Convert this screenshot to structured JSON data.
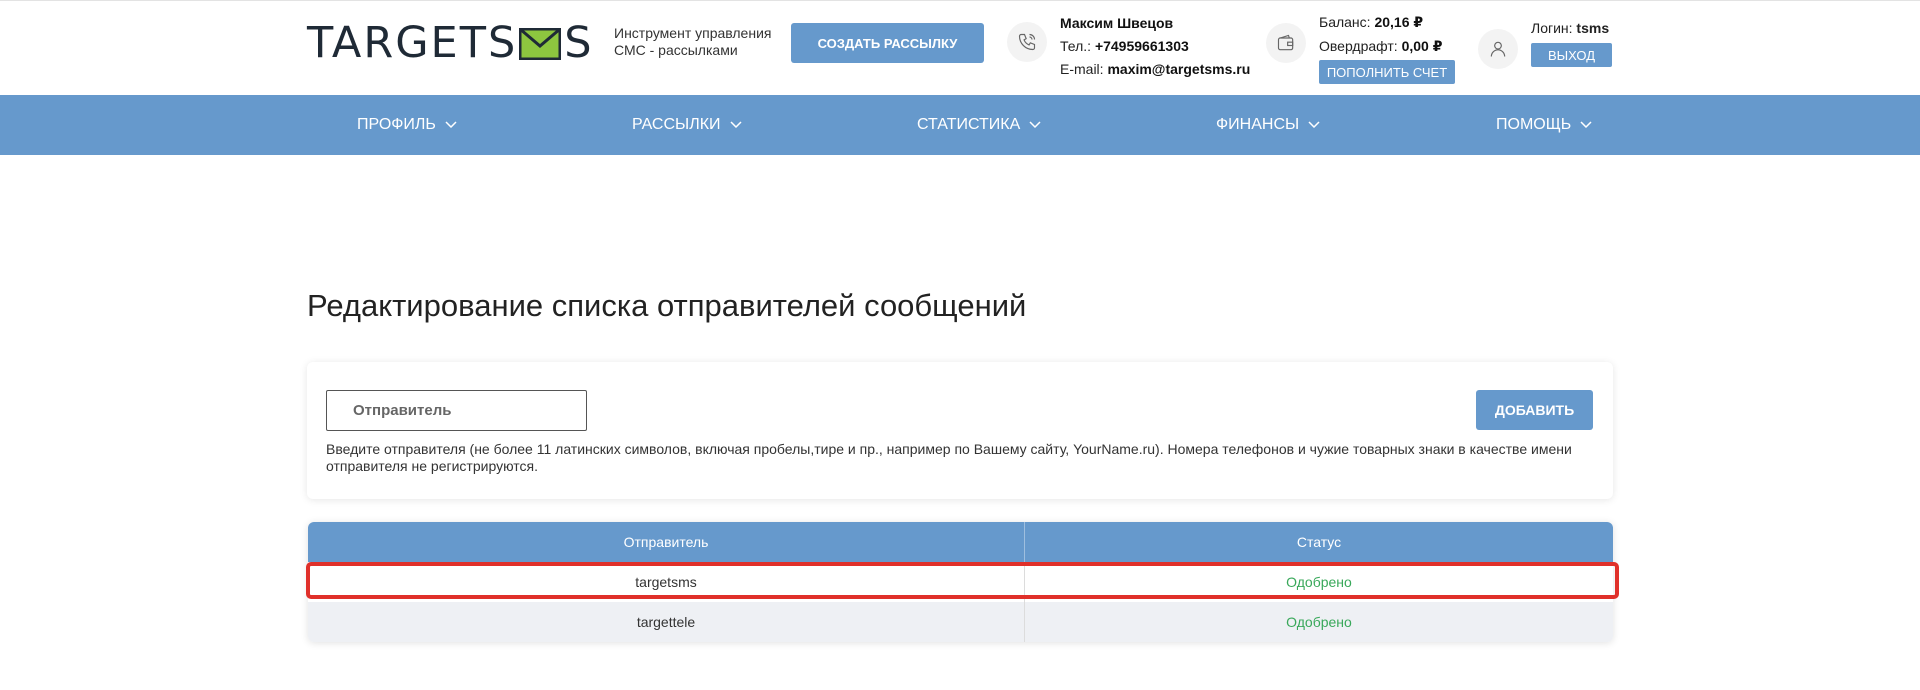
{
  "header": {
    "logo_text_left": "TARGETS",
    "logo_text_right": "S",
    "tagline": "Инструмент управления СМС - рассылками",
    "create_button": "СОЗДАТЬ РАССЫЛКУ",
    "contact": {
      "name": "Максим Швецов",
      "phone_label": "Тел.:",
      "phone": "+74959661303",
      "email_label": "E-mail:",
      "email": "maxim@targetsms.ru"
    },
    "balance": {
      "balance_label": "Баланс:",
      "balance_value": "20,16 ₽",
      "overdraft_label": "Овердрафт:",
      "overdraft_value": "0,00 ₽",
      "topup_button": "ПОПОЛНИТЬ СЧЕТ"
    },
    "account": {
      "login_label": "Логин:",
      "login_value": "tsms",
      "logout_button": "ВЫХОД"
    }
  },
  "nav": {
    "items": [
      {
        "label": "ПРОФИЛЬ"
      },
      {
        "label": "РАССЫЛКИ"
      },
      {
        "label": "СТАТИСТИКА"
      },
      {
        "label": "ФИНАНСЫ"
      },
      {
        "label": "ПОМОЩЬ"
      }
    ]
  },
  "main": {
    "title": "Редактирование списка отправителей сообщений",
    "sender_input": {
      "placeholder": "Отправитель",
      "value": ""
    },
    "add_button": "ДОБАВИТЬ",
    "hint": "Введите отправителя (не более 11 латинских символов, включая пробелы,тире и пр., например по Вашему сайту, YourName.ru). Номера телефонов и чужие товарных знаки в качестве имени отправителя не регистрируются."
  },
  "table": {
    "columns": [
      "Отправитель",
      "Статус"
    ],
    "rows": [
      {
        "sender": "targetsms",
        "status": "Одобрено",
        "highlighted": true
      },
      {
        "sender": "targettele",
        "status": "Одобрено",
        "highlighted": false
      }
    ]
  },
  "colors": {
    "accent": "#6699cc",
    "status_approved": "#39a85a",
    "highlight": "#e0302a",
    "logo_envelope": "#8dc63f"
  }
}
